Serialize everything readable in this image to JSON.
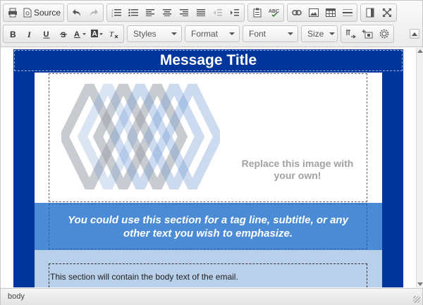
{
  "toolbar": {
    "print_icon": "print-icon",
    "source_label": "Source",
    "undo_icon": "undo-icon",
    "redo_icon": "redo-icon",
    "styles_placeholder": "Styles",
    "format_placeholder": "Format",
    "font_placeholder": "Font",
    "size_placeholder": "Size"
  },
  "email": {
    "title": "Message Title",
    "image_placeholder": "Replace this image with your own!",
    "tagline": "You could use this section for a tag line, subtitle, or any other text you wish to emphasize.",
    "body": "This section will contain the body text of the email."
  },
  "status": {
    "element_path": "body"
  },
  "colors": {
    "frame_blue": "#00369b",
    "tagline_blue": "#4b8bd6",
    "body_light_blue": "#b8d0ea"
  }
}
